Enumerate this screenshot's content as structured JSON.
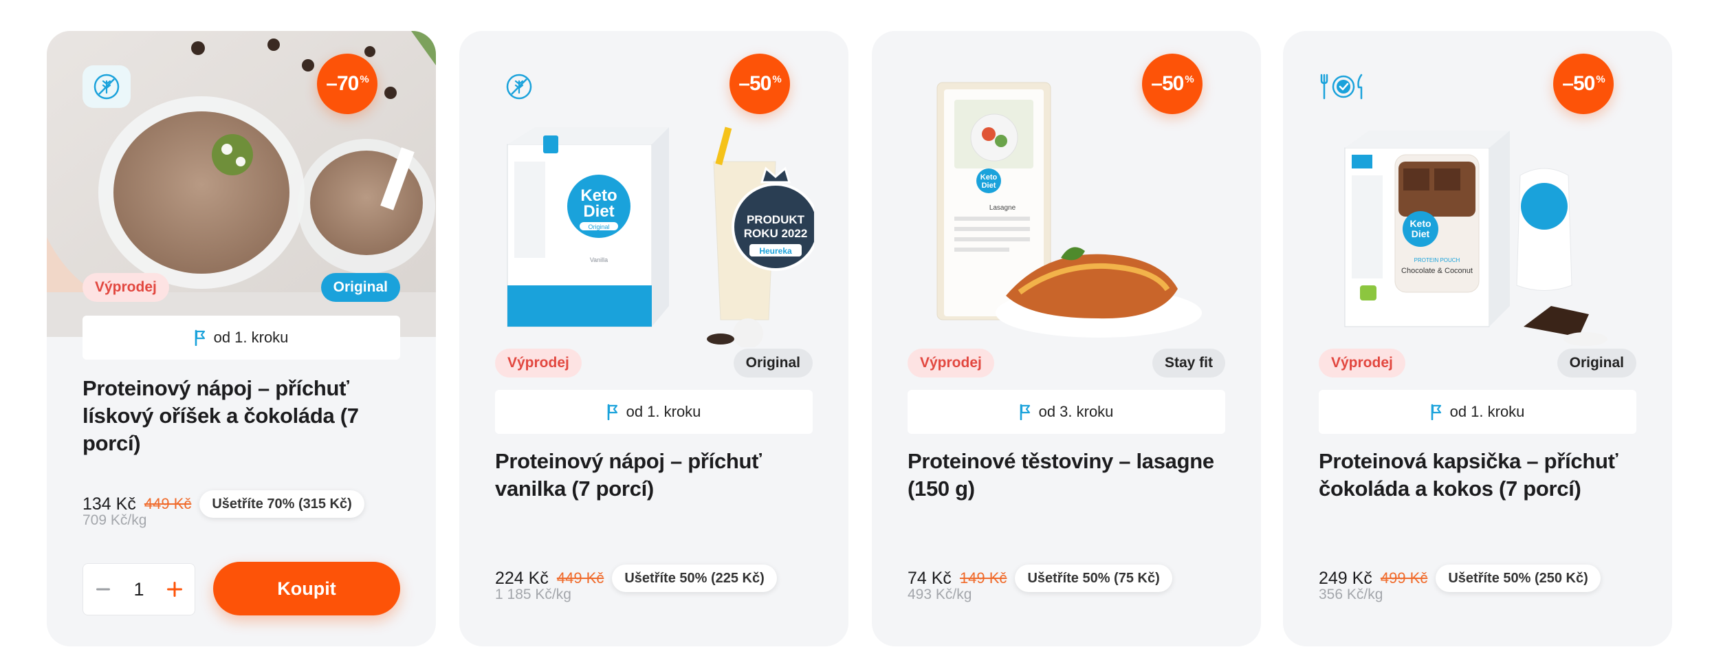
{
  "cards": [
    {
      "discount": "–70",
      "discount_suffix": "%",
      "sale_label": "Výprodej",
      "line_label": "Original",
      "step": "od 1. kroku",
      "title": "Proteinový nápoj – příchuť lískový oříšek a čokoláda (7 porcí)",
      "price": "134 Kč",
      "old_price": "449 Kč",
      "savings": "Ušetříte 70% (315 Kč)",
      "unit_price": "709 Kč/kg",
      "quantity": "1",
      "buy_label": "Koupit",
      "icon": "gluten-free-icon"
    },
    {
      "discount": "–50",
      "discount_suffix": "%",
      "sale_label": "Výprodej",
      "line_label": "Original",
      "step": "od 1. kroku",
      "title": "Proteinový nápoj – příchuť vanilka (7 porcí)",
      "price": "224 Kč",
      "old_price": "449 Kč",
      "savings": "Ušetříte 50% (225 Kč)",
      "unit_price": "1 185 Kč/kg",
      "icon": "gluten-free-icon",
      "award": {
        "line1": "PRODUKT",
        "line2": "ROKU 2022",
        "brand": "Heureka"
      },
      "pack_brand": {
        "line1": "Keto",
        "line2": "Diet",
        "sub": "Original",
        "flavor": "Vanilla"
      }
    },
    {
      "discount": "–50",
      "discount_suffix": "%",
      "sale_label": "Výprodej",
      "line_label": "Stay fit",
      "step": "od 3. kroku",
      "title": "Proteinové těstoviny – lasagne (150 g)",
      "price": "74 Kč",
      "old_price": "149 Kč",
      "savings": "Ušetříte 50% (75 Kč)",
      "unit_price": "493 Kč/kg",
      "pack_brand": {
        "line1": "Keto",
        "line2": "Diet",
        "flavor": "Lasagne"
      }
    },
    {
      "discount": "–50",
      "discount_suffix": "%",
      "sale_label": "Výprodej",
      "line_label": "Original",
      "step": "od 1. kroku",
      "title": "Proteinová kapsička – příchuť čokoláda a kokos (7 porcí)",
      "price": "249 Kč",
      "old_price": "499 Kč",
      "savings": "Ušetříte 50% (250 Kč)",
      "unit_price": "356 Kč/kg",
      "icon": "meal-replacement-icon",
      "pack_brand": {
        "line1": "Keto",
        "line2": "Diet",
        "sub": "PROTEIN POUCH",
        "flavor": "Chocolate & Coconut"
      }
    }
  ],
  "colors": {
    "accent": "#fd5308",
    "brand_blue": "#1aa2db",
    "sale_bg": "#fde3e3",
    "sale_text": "#e2473f",
    "card_bg": "#f4f5f7"
  }
}
